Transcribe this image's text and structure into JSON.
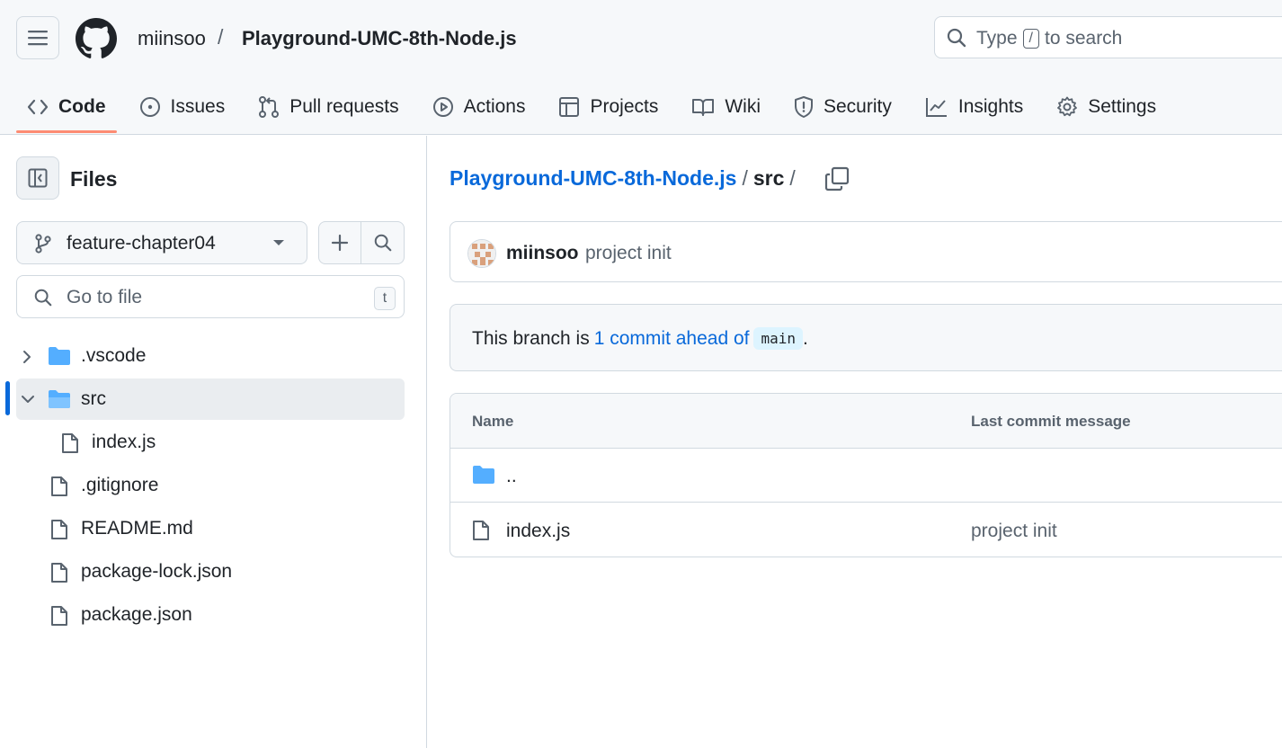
{
  "header": {
    "owner": "miinsoo",
    "separator": "/",
    "repo": "Playground-UMC-8th-Node.js",
    "search": {
      "prefix": "Type",
      "key": "/",
      "suffix": "to search"
    }
  },
  "tabs": [
    {
      "label": "Code",
      "icon": "code-icon",
      "active": true
    },
    {
      "label": "Issues",
      "icon": "issue-icon"
    },
    {
      "label": "Pull requests",
      "icon": "pull-request-icon"
    },
    {
      "label": "Actions",
      "icon": "play-icon"
    },
    {
      "label": "Projects",
      "icon": "table-icon"
    },
    {
      "label": "Wiki",
      "icon": "book-icon"
    },
    {
      "label": "Security",
      "icon": "shield-icon"
    },
    {
      "label": "Insights",
      "icon": "graph-icon"
    },
    {
      "label": "Settings",
      "icon": "gear-icon"
    }
  ],
  "sidebar": {
    "title": "Files",
    "branch": "feature-chapter04",
    "goto_placeholder": "Go to file",
    "goto_shortcut": "t",
    "tree": [
      {
        "name": ".vscode",
        "type": "folder",
        "expanded": false
      },
      {
        "name": "src",
        "type": "folder",
        "expanded": true,
        "selected": true
      },
      {
        "name": "index.js",
        "type": "file",
        "depth": 1
      },
      {
        "name": ".gitignore",
        "type": "file"
      },
      {
        "name": "README.md",
        "type": "file"
      },
      {
        "name": "package-lock.json",
        "type": "file"
      },
      {
        "name": "package.json",
        "type": "file"
      }
    ]
  },
  "main": {
    "breadcrumb": {
      "repo": "Playground-UMC-8th-Node.js",
      "sep": "/",
      "dir": "src"
    },
    "commit": {
      "user": "miinsoo",
      "message": "project init"
    },
    "branch_info": {
      "prefix": "This branch is",
      "link": "1 commit ahead of",
      "base": "main",
      "suffix": "."
    },
    "table": {
      "headers": {
        "name": "Name",
        "message": "Last commit message"
      },
      "rows": [
        {
          "name": "..",
          "type": "folder",
          "message": ""
        },
        {
          "name": "index.js",
          "type": "file",
          "message": "project init"
        }
      ]
    }
  },
  "colors": {
    "accent": "#0969da",
    "tab_underline": "#fd8c73",
    "folder": "#54aeff"
  }
}
